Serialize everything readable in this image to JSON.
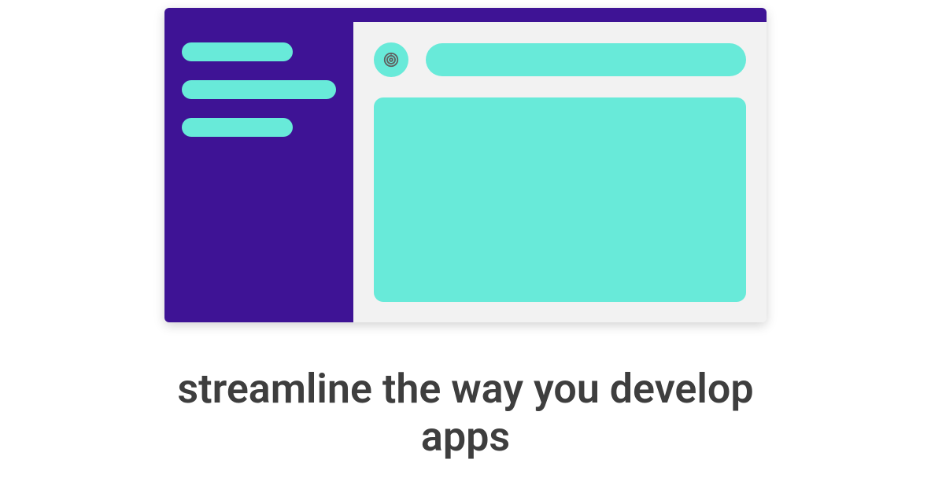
{
  "caption": "streamline the way you develop apps",
  "colors": {
    "accent": "#68ead9",
    "deep": "#3e1395",
    "text": "#3e3e3e",
    "panel_bg": "#f2f2f2"
  },
  "illustration": {
    "sidebar_items": 3,
    "profile_icon": "fingerprint-icon"
  }
}
